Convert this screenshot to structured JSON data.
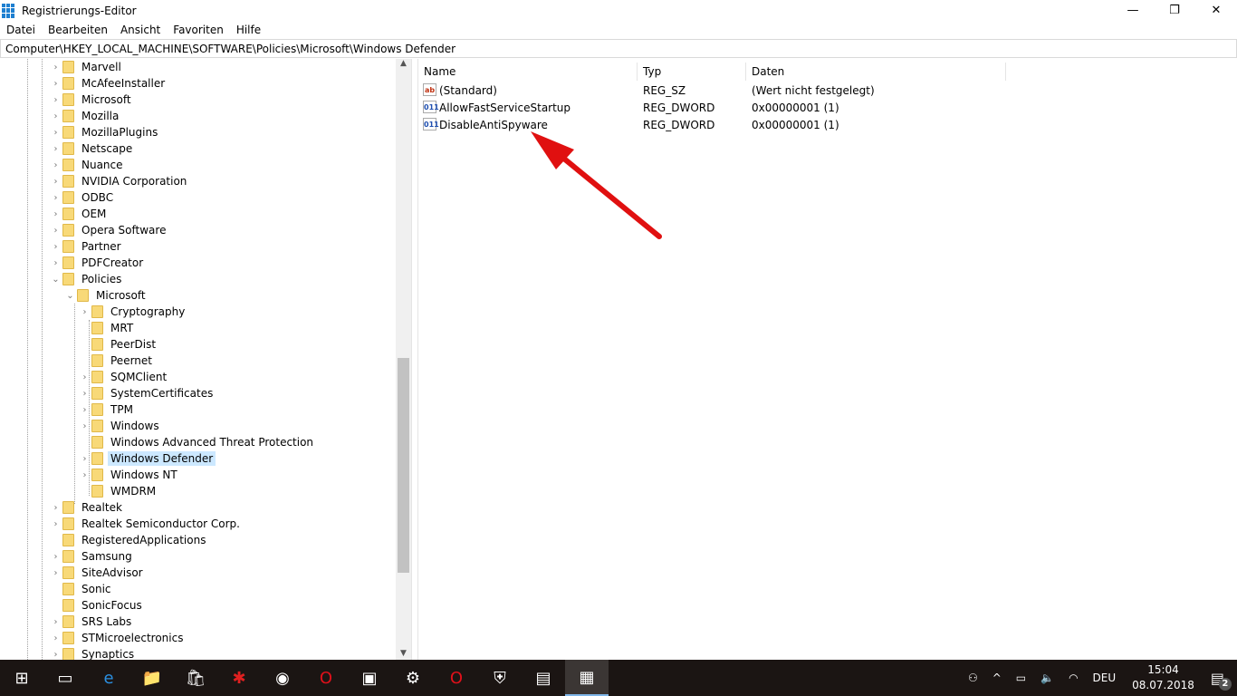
{
  "window": {
    "title": "Registrierungs-Editor",
    "minimize": "—",
    "maximize": "❐",
    "close": "✕"
  },
  "menu": [
    "Datei",
    "Bearbeiten",
    "Ansicht",
    "Favoriten",
    "Hilfe"
  ],
  "address": "Computer\\HKEY_LOCAL_MACHINE\\SOFTWARE\\Policies\\Microsoft\\Windows Defender",
  "tree": [
    {
      "label": "Marvell",
      "level": 0,
      "chev": ">"
    },
    {
      "label": "McAfeeInstaller",
      "level": 0,
      "chev": ">"
    },
    {
      "label": "Microsoft",
      "level": 0,
      "chev": ">"
    },
    {
      "label": "Mozilla",
      "level": 0,
      "chev": ">"
    },
    {
      "label": "MozillaPlugins",
      "level": 0,
      "chev": ">"
    },
    {
      "label": "Netscape",
      "level": 0,
      "chev": ">"
    },
    {
      "label": "Nuance",
      "level": 0,
      "chev": ">"
    },
    {
      "label": "NVIDIA Corporation",
      "level": 0,
      "chev": ">"
    },
    {
      "label": "ODBC",
      "level": 0,
      "chev": ">"
    },
    {
      "label": "OEM",
      "level": 0,
      "chev": ">"
    },
    {
      "label": "Opera Software",
      "level": 0,
      "chev": ">"
    },
    {
      "label": "Partner",
      "level": 0,
      "chev": ">"
    },
    {
      "label": "PDFCreator",
      "level": 0,
      "chev": ">"
    },
    {
      "label": "Policies",
      "level": 0,
      "chev": "v"
    },
    {
      "label": "Microsoft",
      "level": 1,
      "chev": "v"
    },
    {
      "label": "Cryptography",
      "level": 2,
      "chev": ">"
    },
    {
      "label": "MRT",
      "level": 2,
      "chev": ""
    },
    {
      "label": "PeerDist",
      "level": 2,
      "chev": ""
    },
    {
      "label": "Peernet",
      "level": 2,
      "chev": ""
    },
    {
      "label": "SQMClient",
      "level": 2,
      "chev": ">"
    },
    {
      "label": "SystemCertificates",
      "level": 2,
      "chev": ">"
    },
    {
      "label": "TPM",
      "level": 2,
      "chev": ">"
    },
    {
      "label": "Windows",
      "level": 2,
      "chev": ">"
    },
    {
      "label": "Windows Advanced Threat Protection",
      "level": 2,
      "chev": ""
    },
    {
      "label": "Windows Defender",
      "level": 2,
      "chev": ">",
      "selected": true
    },
    {
      "label": "Windows NT",
      "level": 2,
      "chev": ">"
    },
    {
      "label": "WMDRM",
      "level": 2,
      "chev": ""
    },
    {
      "label": "Realtek",
      "level": 0,
      "chev": ">"
    },
    {
      "label": "Realtek Semiconductor Corp.",
      "level": 0,
      "chev": ">"
    },
    {
      "label": "RegisteredApplications",
      "level": 0,
      "chev": ""
    },
    {
      "label": "Samsung",
      "level": 0,
      "chev": ">"
    },
    {
      "label": "SiteAdvisor",
      "level": 0,
      "chev": ">"
    },
    {
      "label": "Sonic",
      "level": 0,
      "chev": ""
    },
    {
      "label": "SonicFocus",
      "level": 0,
      "chev": ""
    },
    {
      "label": "SRS Labs",
      "level": 0,
      "chev": ">"
    },
    {
      "label": "STMicroelectronics",
      "level": 0,
      "chev": ">"
    },
    {
      "label": "Synaptics",
      "level": 0,
      "chev": ">"
    }
  ],
  "columns": {
    "name": "Name",
    "type": "Typ",
    "data": "Daten"
  },
  "values": [
    {
      "name": "(Standard)",
      "type": "REG_SZ",
      "data": "(Wert nicht festgelegt)",
      "icon": "ab"
    },
    {
      "name": "AllowFastServiceStartup",
      "type": "REG_DWORD",
      "data": "0x00000001 (1)",
      "icon": "011"
    },
    {
      "name": "DisableAntiSpyware",
      "type": "REG_DWORD",
      "data": "0x00000001 (1)",
      "icon": "011"
    }
  ],
  "annotation": {
    "color": "#e01010"
  },
  "taskbar": {
    "apps": [
      {
        "name": "start-icon",
        "glyph": "⊞"
      },
      {
        "name": "task-view-icon",
        "glyph": "▭"
      },
      {
        "name": "edge-icon",
        "glyph": "e"
      },
      {
        "name": "file-explorer-icon",
        "glyph": "📁"
      },
      {
        "name": "store-icon",
        "glyph": "🛍"
      },
      {
        "name": "red-app-icon",
        "glyph": "✱"
      },
      {
        "name": "app-icon",
        "glyph": "◉"
      },
      {
        "name": "opera-icon",
        "glyph": "O"
      },
      {
        "name": "cmd-icon",
        "glyph": "▣"
      },
      {
        "name": "settings-icon",
        "glyph": "⚙"
      },
      {
        "name": "opera-icon-2",
        "glyph": "O"
      },
      {
        "name": "defender-icon",
        "glyph": "⛨"
      },
      {
        "name": "notes-icon",
        "glyph": "▤"
      },
      {
        "name": "regedit-icon",
        "glyph": "▦",
        "active": true
      }
    ],
    "lang": "DEU",
    "time": "15:04",
    "date": "08.07.2018",
    "notifications": "2"
  }
}
